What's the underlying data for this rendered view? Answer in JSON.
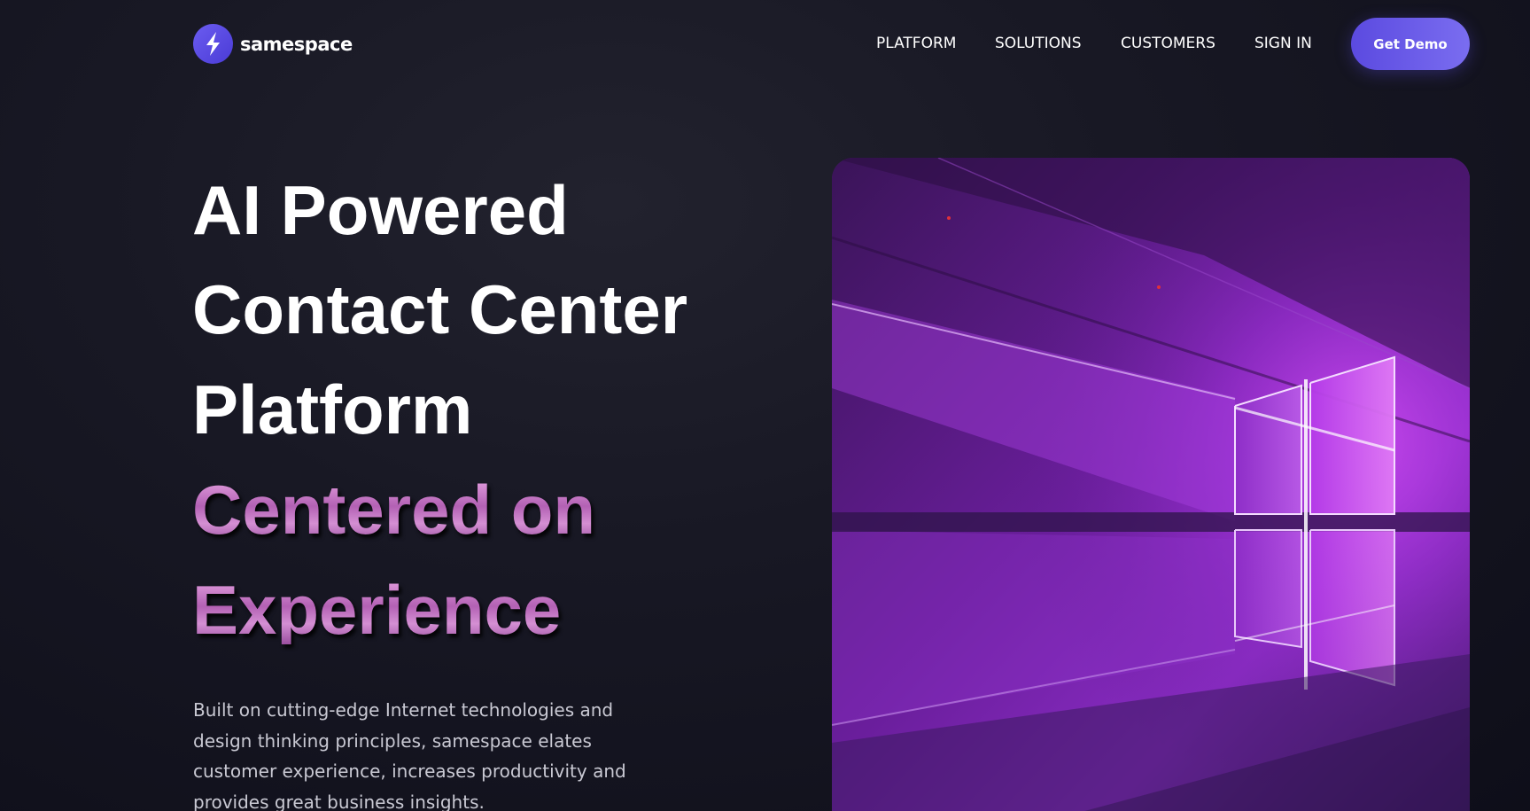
{
  "brand": {
    "name": "samespace",
    "logo_icon": "samespace-logo-icon",
    "accent_color": "#5b4ae0"
  },
  "nav": {
    "items": [
      {
        "label": "PLATFORM"
      },
      {
        "label": "SOLUTIONS"
      },
      {
        "label": "CUSTOMERS"
      },
      {
        "label": "SIGN IN"
      }
    ],
    "cta_label": "Get Demo"
  },
  "hero": {
    "title_lines": [
      "AI Powered",
      "Contact Center",
      "Platform"
    ],
    "highlight_lines": [
      "Centered on",
      "Experience"
    ],
    "description": "Built on cutting-edge Internet technologies and design thinking principles, samespace elates customer experience, increases productivity and provides great business insights.",
    "image_icon": "windows-light-illustration"
  }
}
